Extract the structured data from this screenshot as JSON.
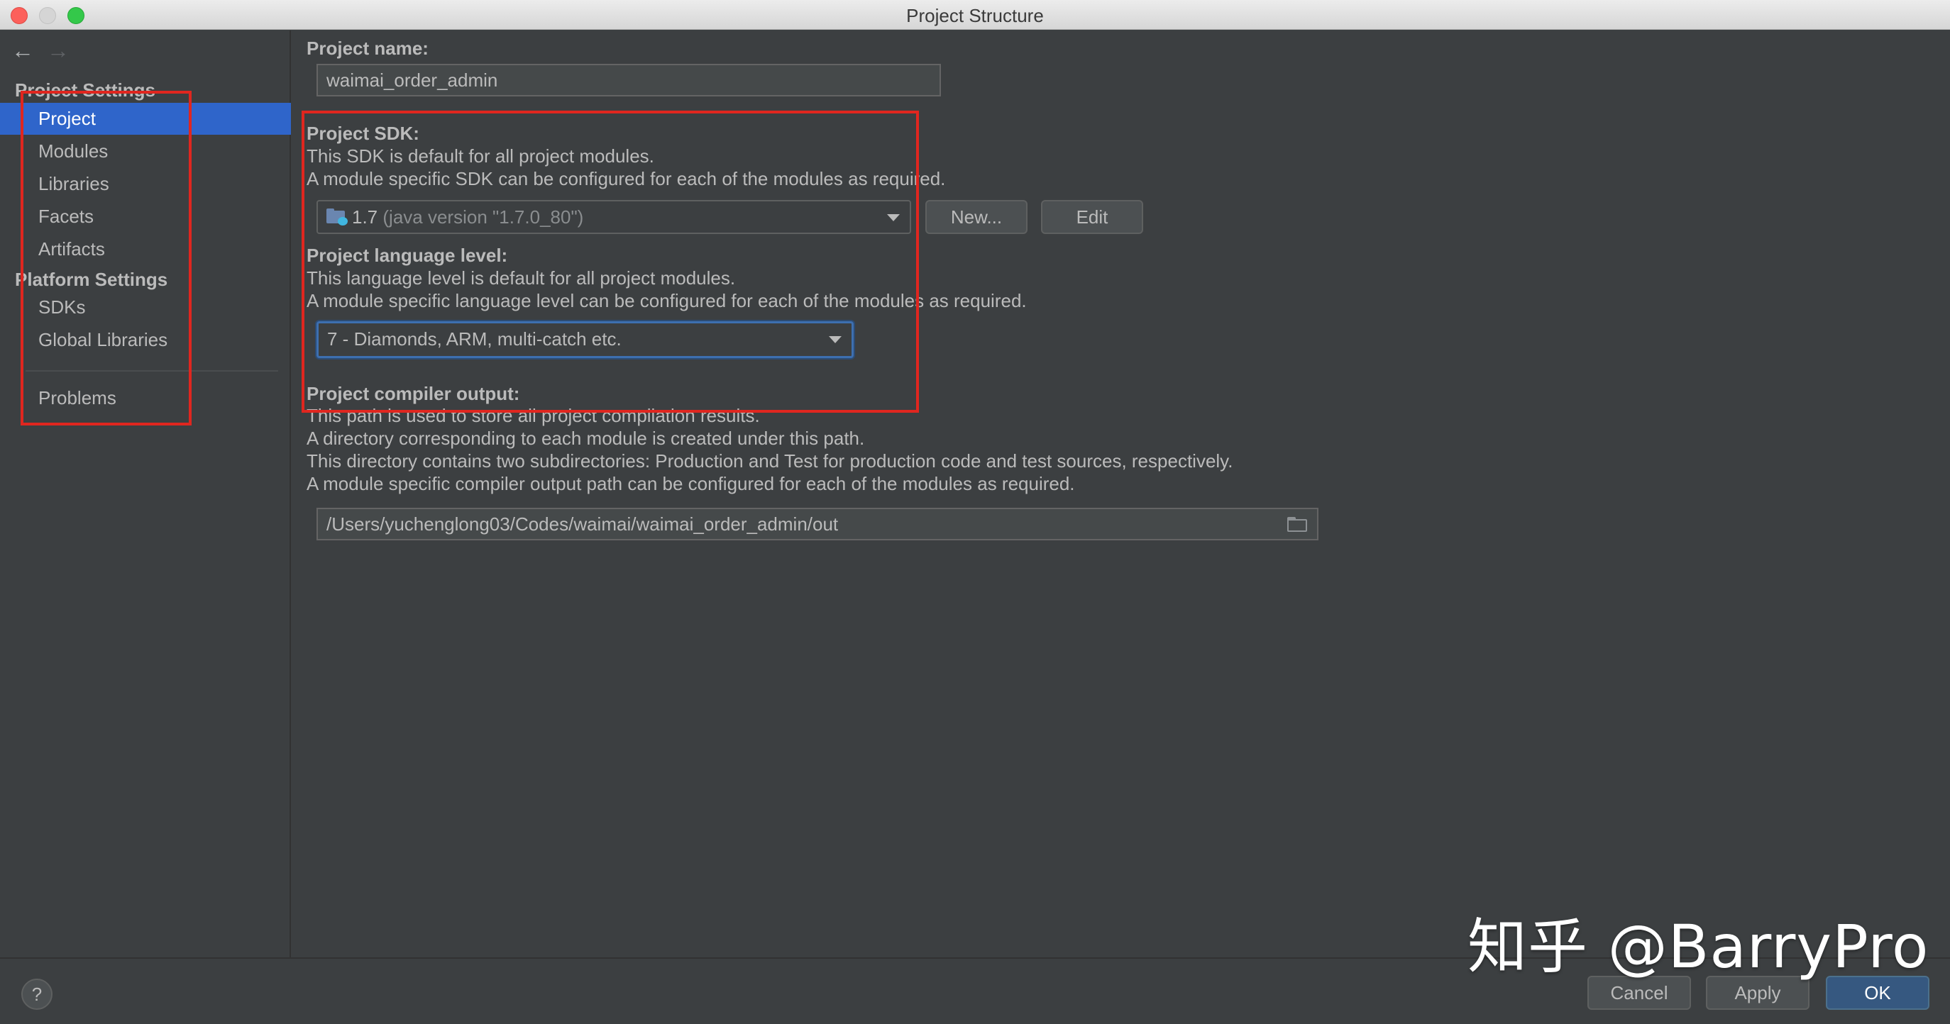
{
  "window": {
    "title": "Project Structure"
  },
  "sidebar": {
    "project_settings_header": "Project Settings",
    "platform_settings_header": "Platform Settings",
    "items": [
      {
        "label": "Project",
        "selected": true
      },
      {
        "label": "Modules"
      },
      {
        "label": "Libraries"
      },
      {
        "label": "Facets"
      },
      {
        "label": "Artifacts"
      },
      {
        "label": "SDKs"
      },
      {
        "label": "Global Libraries"
      },
      {
        "label": "Problems"
      }
    ]
  },
  "main": {
    "project_name": {
      "label": "Project name:",
      "value": "waimai_order_admin"
    },
    "sdk": {
      "label": "Project SDK:",
      "desc1": "This SDK is default for all project modules.",
      "desc2": "A module specific SDK can be configured for each of the modules as required.",
      "selected_version": "1.7",
      "selected_detail": "(java version \"1.7.0_80\")",
      "new_button": "New...",
      "edit_button": "Edit"
    },
    "language_level": {
      "label": "Project language level:",
      "desc1": "This language level is default for all project modules.",
      "desc2": "A module specific language level can be configured for each of the modules as required.",
      "selected": "7 - Diamonds, ARM, multi-catch etc."
    },
    "compiler_output": {
      "label": "Project compiler output:",
      "desc1": "This path is used to store all project compilation results.",
      "desc2": "A directory corresponding to each module is created under this path.",
      "desc3": "This directory contains two subdirectories: Production and Test for production code and test sources, respectively.",
      "desc4": "A module specific compiler output path can be configured for each of the modules as required.",
      "path": "/Users/yuchenglong03/Codes/waimai/waimai_order_admin/out"
    }
  },
  "footer": {
    "help": "?",
    "cancel": "Cancel",
    "apply": "Apply",
    "ok": "OK"
  },
  "watermark": "知乎 @BarryPro",
  "colors": {
    "background": "#3c3f41",
    "selection": "#2f65ca",
    "annotation_red": "#e0261f",
    "primary_button": "#365880"
  }
}
